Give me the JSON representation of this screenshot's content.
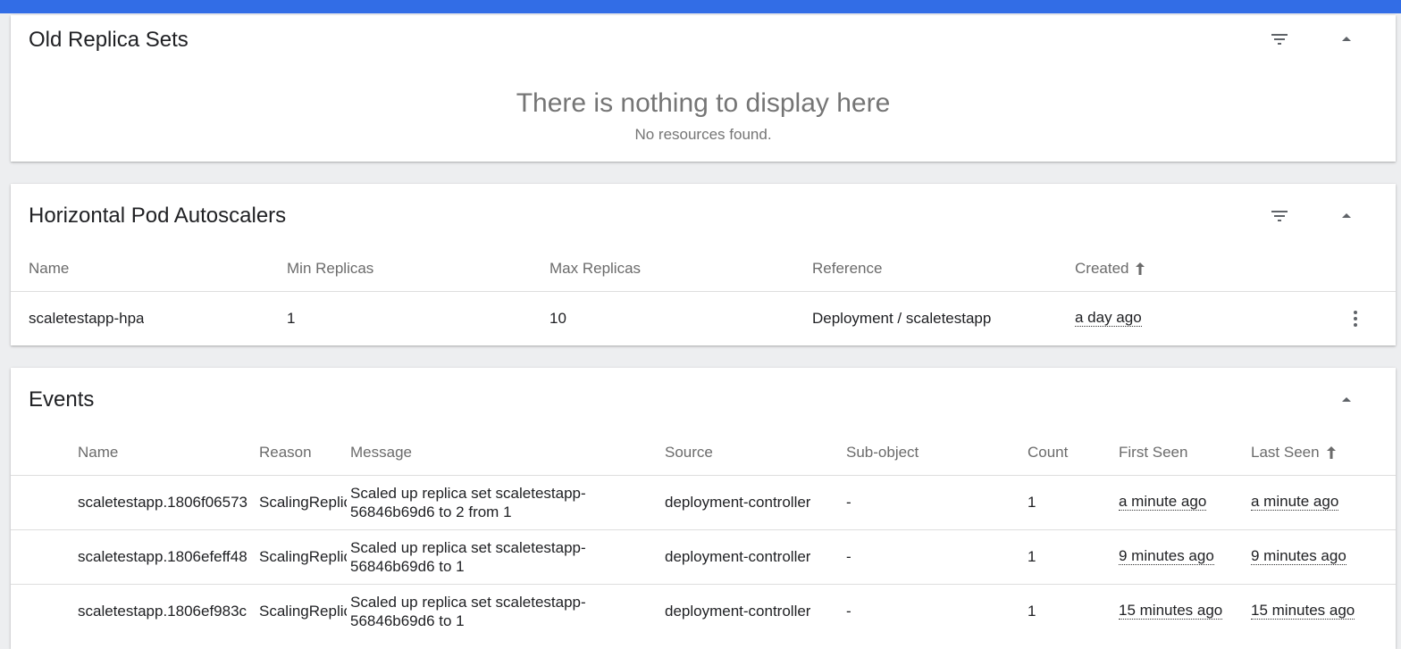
{
  "old_replica_sets": {
    "title": "Old Replica Sets",
    "empty_title": "There is nothing to display here",
    "empty_subtitle": "No resources found."
  },
  "hpa": {
    "title": "Horizontal Pod Autoscalers",
    "columns": [
      "Name",
      "Min Replicas",
      "Max Replicas",
      "Reference",
      "Created"
    ],
    "rows": [
      {
        "name": "scaletestapp-hpa",
        "min": "1",
        "max": "10",
        "reference": "Deployment / scaletestapp",
        "created": "a day ago"
      }
    ]
  },
  "events": {
    "title": "Events",
    "columns": [
      "Name",
      "Reason",
      "Message",
      "Source",
      "Sub-object",
      "Count",
      "First Seen",
      "Last Seen"
    ],
    "rows": [
      {
        "name": "scaletestapp.1806f06573",
        "reason": "ScalingReplicaSet",
        "message": "Scaled up replica set scaletestapp-56846b69d6 to 2 from 1",
        "source": "deployment-controller",
        "subobject": "-",
        "count": "1",
        "first_seen": "a minute ago",
        "last_seen": "a minute ago"
      },
      {
        "name": "scaletestapp.1806efeff48",
        "reason": "ScalingReplicaSet",
        "message": "Scaled up replica set scaletestapp-56846b69d6 to 1",
        "source": "deployment-controller",
        "subobject": "-",
        "count": "1",
        "first_seen": "9 minutes ago",
        "last_seen": "9 minutes ago"
      },
      {
        "name": "scaletestapp.1806ef983c",
        "reason": "ScalingReplicaSet",
        "message": "Scaled up replica set scaletestapp-56846b69d6 to 1",
        "source": "deployment-controller",
        "subobject": "-",
        "count": "1",
        "first_seen": "15 minutes ago",
        "last_seen": "15 minutes ago"
      }
    ]
  },
  "icons": {
    "filter": "filter-icon",
    "collapse": "collapse-arrow-icon",
    "sort": "sort-ascending-icon",
    "menu": "more-vert-icon"
  },
  "colors": {
    "accent": "#326de6",
    "background": "#edeef0"
  }
}
